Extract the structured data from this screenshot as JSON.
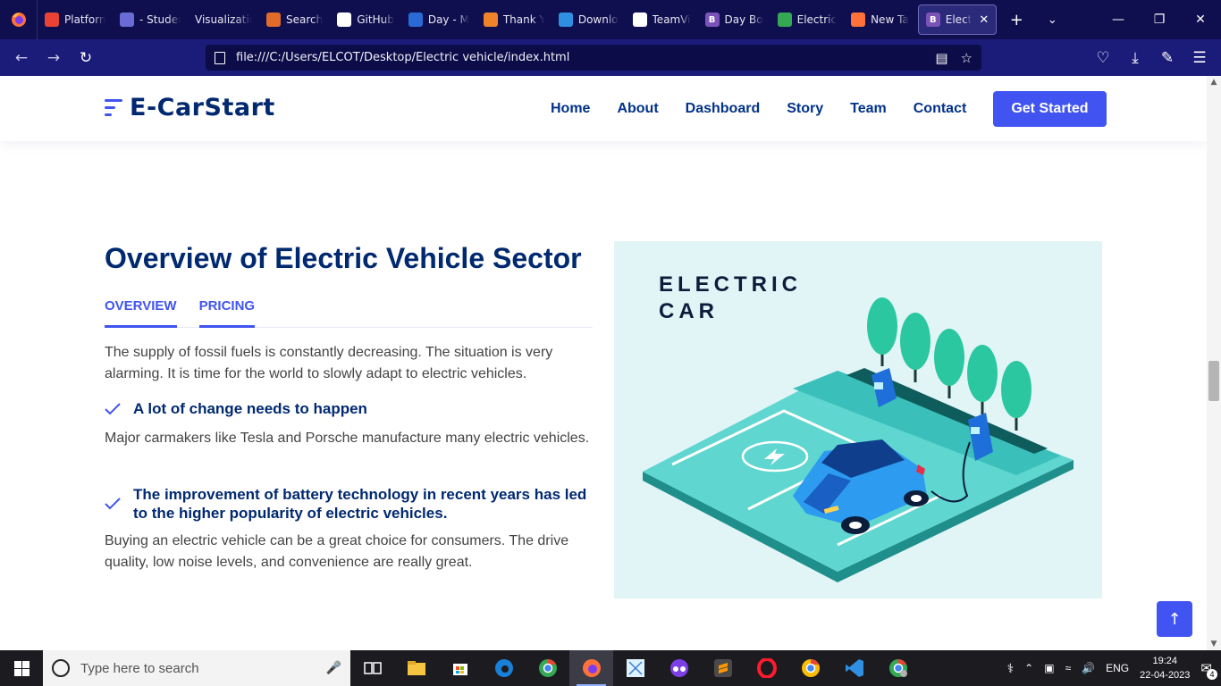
{
  "browser": {
    "tabs": [
      {
        "label": "Platform",
        "icon": "gmail-icon",
        "color": "#ea4335"
      },
      {
        "label": "- Student",
        "icon": "window-icon",
        "color": "#6b6bd6"
      },
      {
        "label": "Visualization",
        "icon": "none",
        "color": ""
      },
      {
        "label": "Search",
        "icon": "dots-icon",
        "color": "#e06b2a"
      },
      {
        "label": "GitHub",
        "icon": "github-icon",
        "color": "#ffffff"
      },
      {
        "label": "Day - M",
        "icon": "arrow-icon",
        "color": "#2a6ad6"
      },
      {
        "label": "Thank Y",
        "icon": "sublime-icon",
        "color": "#f0822a"
      },
      {
        "label": "Downlo",
        "icon": "vscode-icon",
        "color": "#2f8fe0"
      },
      {
        "label": "TeamVi",
        "icon": "teamviewer-icon",
        "color": "#ffffff"
      },
      {
        "label": "Day Bo",
        "icon": "bootstrap-icon",
        "color": "#7a53b8"
      },
      {
        "label": "Electric",
        "icon": "drive-icon",
        "color": "#34a853"
      },
      {
        "label": "New Ta",
        "icon": "firefox-icon",
        "color": "#ff7139"
      },
      {
        "label": "Elect",
        "icon": "bootstrap-icon",
        "color": "#7a53b8",
        "active": true
      }
    ],
    "url": "file:///C:/Users/ELCOT/Desktop/Electric vehicle/index.html"
  },
  "site": {
    "brand": "E-CarStart",
    "nav": [
      "Home",
      "About",
      "Dashboard",
      "Story",
      "Team",
      "Contact"
    ],
    "cta": "Get Started",
    "accent": "#4154f1",
    "heading_color": "#012970"
  },
  "overview": {
    "title": "Overview of Electric Vehicle Sector",
    "tabs": [
      "OVERVIEW",
      "PRICING"
    ],
    "intro": "The supply of fossil fuels is constantly decreasing. The situation is very alarming. It is time for the world to slowly adapt to electric vehicles.",
    "features": [
      {
        "title": "A lot of change needs to happen",
        "text": "Major carmakers like Tesla and Porsche manufacture many electric vehicles."
      },
      {
        "title": "The improvement of battery technology in recent years has led to the higher popularity of electric vehicles.",
        "text": "Buying an electric vehicle can be a great choice for consumers. The drive quality, low noise levels, and convenience are really great."
      }
    ],
    "illustration_title_1": "ELECTRIC",
    "illustration_title_2": "CAR"
  },
  "taskbar": {
    "search_placeholder": "Type here to search",
    "language": "ENG",
    "time": "19:24",
    "date": "22-04-2023",
    "notifications": "4"
  }
}
